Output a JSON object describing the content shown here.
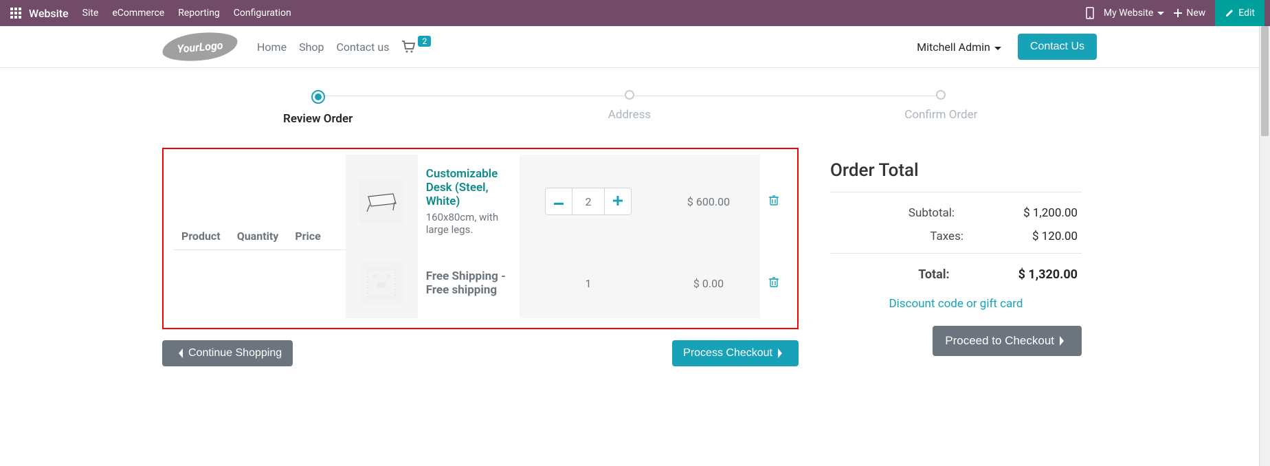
{
  "appbar": {
    "title": "Website",
    "menu": [
      "Site",
      "eCommerce",
      "Reporting",
      "Configuration"
    ],
    "my_website": "My Website",
    "new_label": "New",
    "edit_label": "Edit"
  },
  "header": {
    "logo_text": "YourLogo",
    "nav": {
      "home": "Home",
      "shop": "Shop",
      "contact_us_link": "Contact us"
    },
    "cart_count": "2",
    "user": "Mitchell Admin",
    "contact_btn": "Contact Us"
  },
  "steps": {
    "review": "Review Order",
    "address": "Address",
    "confirm": "Confirm Order"
  },
  "cart": {
    "headers": {
      "product": "Product",
      "quantity": "Quantity",
      "price": "Price"
    },
    "rows": [
      {
        "name": "Customizable Desk (Steel, White)",
        "desc": "160x80cm, with large legs.",
        "qty": "2",
        "price": "$ 600.00",
        "editable": true
      },
      {
        "name": "Free Shipping - Free shipping",
        "desc": "",
        "qty": "1",
        "price": "$ 0.00",
        "editable": false
      }
    ],
    "continue": "Continue Shopping",
    "process": "Process Checkout"
  },
  "summary": {
    "title": "Order Total",
    "subtotal_label": "Subtotal:",
    "subtotal_value": "$ 1,200.00",
    "taxes_label": "Taxes:",
    "taxes_value": "$ 120.00",
    "total_label": "Total:",
    "total_value": "$ 1,320.00",
    "discount_link": "Discount code or gift card",
    "proceed": "Proceed to Checkout"
  }
}
